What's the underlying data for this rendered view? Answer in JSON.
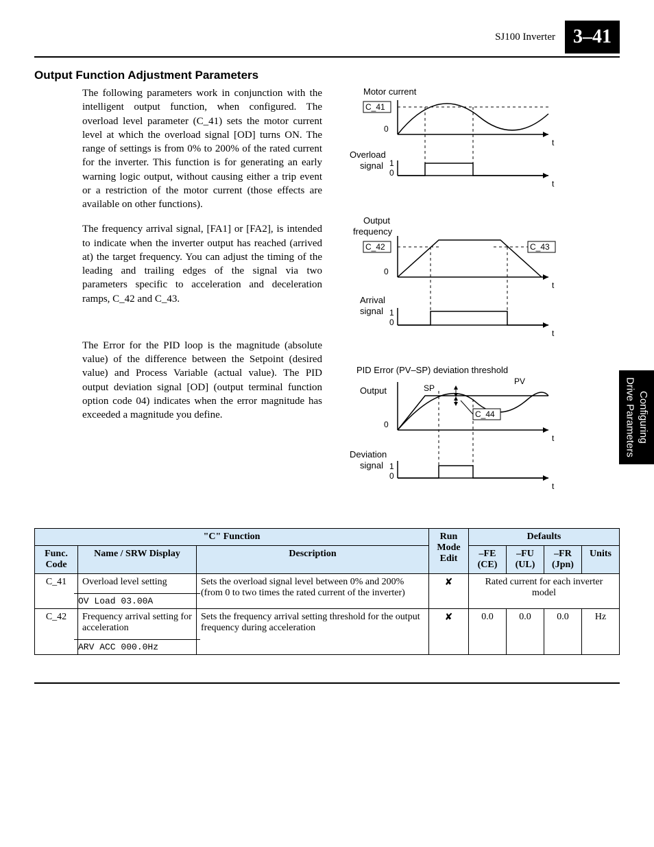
{
  "header": {
    "doc_label": "SJ100 Inverter",
    "page_number": "3–41"
  },
  "side_tab": {
    "line1": "Configuring",
    "line2": "Drive Parameters"
  },
  "section_title": "Output Function Adjustment Parameters",
  "paragraphs": {
    "p1": "The following parameters work in conjunction with the intelligent output function, when configured. The overload level parameter (C_41) sets the motor current level at which the overload signal [OD] turns ON. The range of settings is from 0% to 200% of the rated current for the inverter. This function is for generating an early warning logic output, without causing either a trip event or a restriction of the motor current (those effects are available on other functions).",
    "p2": "The frequency arrival signal, [FA1] or [FA2], is intended to indicate when the inverter output has reached (arrived at) the target frequency. You can adjust the timing of the leading and trailing edges of the signal via two parameters specific to acceleration and deceleration ramps, C_42 and C_43.",
    "p3": "The Error for the PID loop is the magnitude (absolute value) of the difference between the Setpoint (desired value) and Process Variable (actual value). The PID output deviation signal [OD] (output terminal function option code 04) indicates when the error magnitude has exceeded a magnitude you define."
  },
  "diagrams": {
    "d1": {
      "title": "Motor current",
      "box1": "C_41",
      "zero": "0",
      "t": "t",
      "signal_label_l1": "Overload",
      "signal_label_l2": "signal",
      "one": "1"
    },
    "d2": {
      "title_l1": "Output",
      "title_l2": "frequency",
      "box1": "C_42",
      "box2": "C_43",
      "zero": "0",
      "t": "t",
      "signal_label_l1": "Arrival",
      "signal_label_l2": "signal",
      "one": "1"
    },
    "d3": {
      "title": "PID Error (PV–SP) deviation threshold",
      "output": "Output",
      "sp": "SP",
      "pv": "PV",
      "box1": "C_44",
      "zero": "0",
      "t": "t",
      "signal_label_l1": "Deviation",
      "signal_label_l2": "signal",
      "one": "1"
    }
  },
  "table": {
    "head": {
      "c_function": "\"C\" Function",
      "run_mode_edit": "Run Mode Edit",
      "defaults": "Defaults",
      "func_code": "Func. Code",
      "name_srw": "Name / SRW Display",
      "description": "Description",
      "fe_ce": "–FE (CE)",
      "fu_ul": "–FU (UL)",
      "fr_jpn": "–FR (Jpn)",
      "units": "Units"
    },
    "rows": [
      {
        "code": "C_41",
        "name": "Overload level setting",
        "srw": "OV Load    03.00A",
        "desc": "Sets the overload signal level between 0% and 200% (from 0 to two times the rated current of the inverter)",
        "run_mode": "✘",
        "defaults_merged": "Rated current for each inverter model",
        "fe": "",
        "fu": "",
        "fr": "",
        "units": ""
      },
      {
        "code": "C_42",
        "name": "Frequency arrival setting for acceleration",
        "srw": "ARV ACC   000.0Hz",
        "desc": "Sets the frequency arrival setting threshold for the output frequency during acceleration",
        "run_mode": "✘",
        "defaults_merged": "",
        "fe": "0.0",
        "fu": "0.0",
        "fr": "0.0",
        "units": "Hz"
      }
    ]
  }
}
